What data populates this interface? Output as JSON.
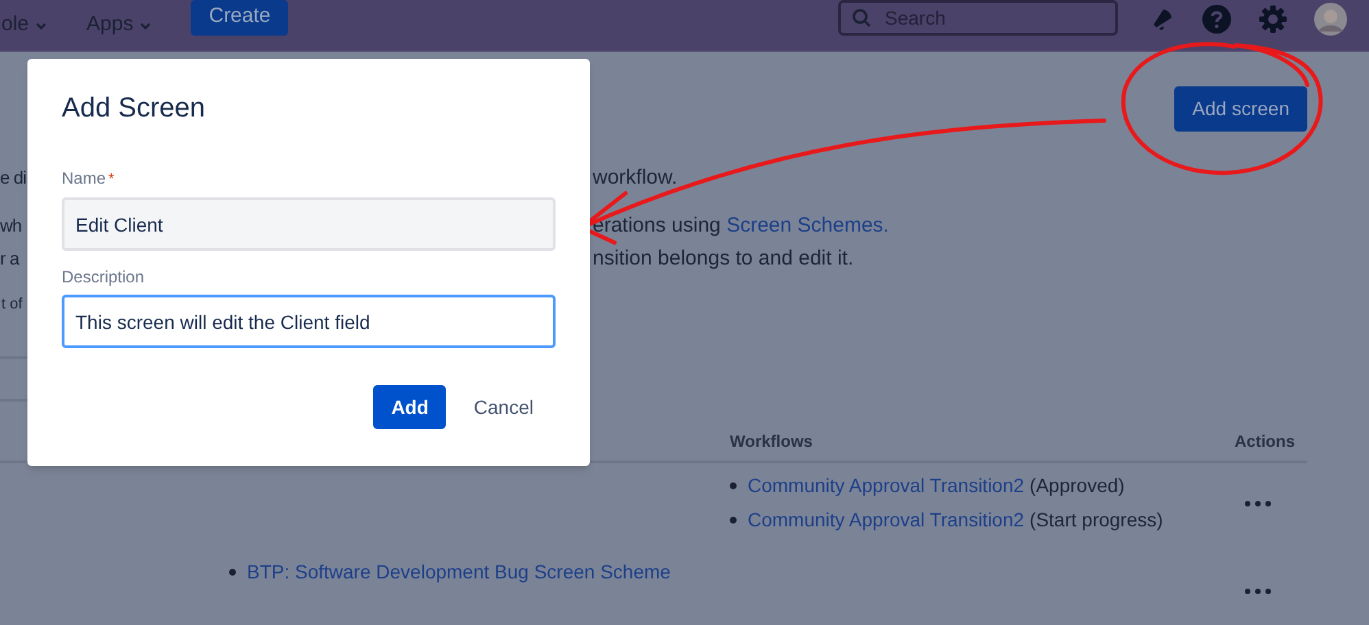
{
  "top_nav": {
    "menus": [
      {
        "label": "ole"
      },
      {
        "label": "Apps"
      }
    ],
    "create_button": "Create",
    "search": {
      "placeholder": "Search"
    }
  },
  "page": {
    "add_screen_button": "Add screen",
    "paragraphs": [
      {
        "left": "e di",
        "right": "workflow."
      },
      {
        "left": "wh",
        "right": "erations using ",
        "link": "Screen Schemes."
      },
      {
        "left": "r a",
        "right": "nsition belongs to and edit it."
      },
      {
        "left": "t of",
        "kind": "small"
      }
    ]
  },
  "table": {
    "columns": [
      "Workflows",
      "Actions"
    ],
    "rows": [
      {
        "workflows": [
          {
            "link": "Community Approval Transition2",
            "note": "(Approved)"
          },
          {
            "link": "Community Approval Transition2",
            "note": "(Start progress)"
          }
        ]
      },
      {
        "column_2": [
          "BTP: Software Development Bug Screen Scheme"
        ]
      }
    ]
  },
  "dialog": {
    "title": "Add Screen",
    "fields": [
      {
        "label": "Name",
        "required": true,
        "required_mark": "*",
        "value": "Edit Client",
        "focused": false
      },
      {
        "label": "Description",
        "required": false,
        "value": "This screen will edit the Client field",
        "focused": true
      }
    ],
    "buttons": [
      {
        "label": "Add",
        "kind": "primary"
      },
      {
        "label": "Cancel",
        "kind": "link"
      }
    ]
  }
}
